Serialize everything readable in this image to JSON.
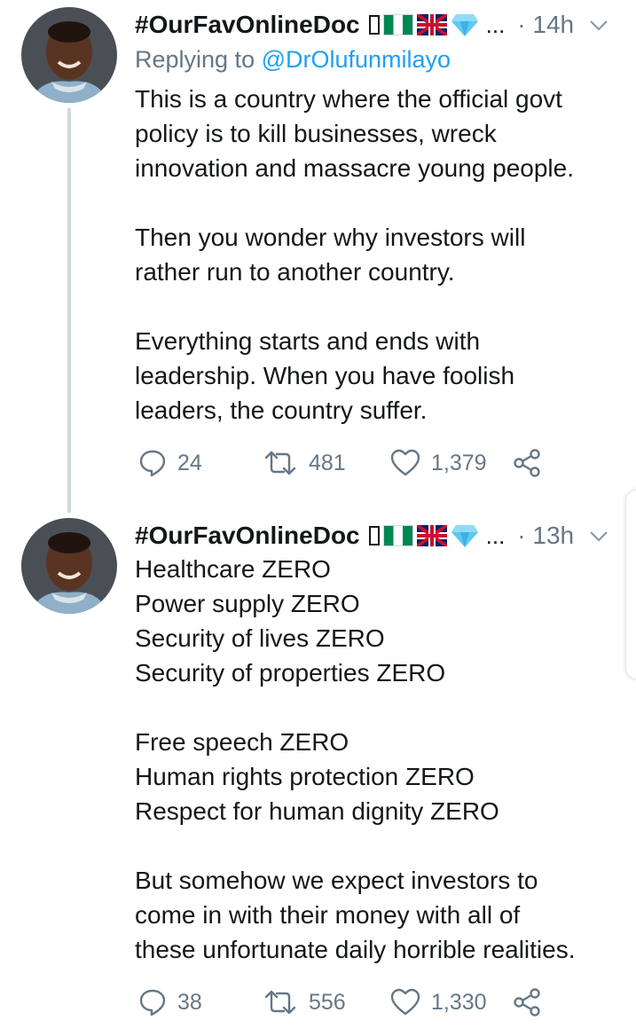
{
  "tweets": [
    {
      "author_name": "#OurFavOnlineDoc",
      "ellipsis": "...",
      "time": "· 14h",
      "replying_prefix": "Replying to ",
      "replying_handle": "@DrOlufunmilayo",
      "lines": [
        "This is a country where the official govt",
        "policy is to kill businesses, wreck",
        "innovation and massacre young people.",
        "",
        "Then you wonder why investors will",
        "rather run to another country.",
        "",
        "Everything starts and ends with",
        "leadership. When you have foolish",
        "leaders, the country suffer."
      ],
      "reply_count": "24",
      "retweet_count": "481",
      "like_count": "1,379"
    },
    {
      "author_name": "#OurFavOnlineDoc",
      "ellipsis": "...",
      "time": "· 13h",
      "lines": [
        "Healthcare ZERO",
        "Power supply ZERO",
        "Security of lives ZERO",
        "Security of properties ZERO",
        "",
        "Free speech ZERO",
        "Human rights protection ZERO",
        "Respect for human dignity ZERO",
        "",
        "But somehow we expect investors to",
        "come in with their money with all of",
        "these unfortunate daily horrible realities."
      ],
      "reply_count": "38",
      "retweet_count": "556",
      "like_count": "1,330"
    }
  ],
  "icons": [
    "reply-icon",
    "retweet-icon",
    "like-icon",
    "share-icon",
    "chevron-down-icon"
  ],
  "colors": {
    "text": "#14171a",
    "secondary": "#657786",
    "link": "#1da1f2"
  }
}
